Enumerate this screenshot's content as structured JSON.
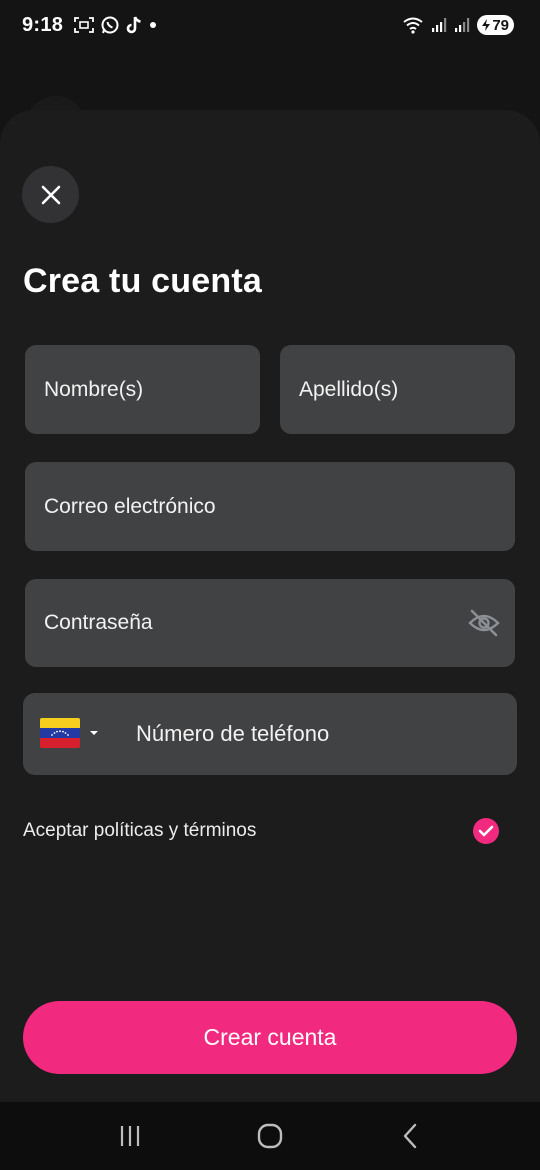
{
  "status_bar": {
    "time": "9:18",
    "left_icons": [
      "screenshot-icon",
      "whatsapp-icon",
      "tiktok-icon",
      "notification-dot-icon"
    ],
    "right_icons": [
      "wifi-icon",
      "signal-icon",
      "signal-icon"
    ],
    "battery_level": "79"
  },
  "header": {
    "close_icon": "close-icon",
    "title": "Crea tu cuenta"
  },
  "form": {
    "first_name_placeholder": "Nombre(s)",
    "last_name_placeholder": "Apellido(s)",
    "email_placeholder": "Correo electrónico",
    "password_placeholder": "Contraseña",
    "password_toggle_icon": "eye-off-icon",
    "phone": {
      "country_flag": "venezuela-flag-icon",
      "dropdown_icon": "caret-down-icon",
      "placeholder": "Número de teléfono"
    },
    "terms_label": "Aceptar políticas y términos",
    "terms_checked": true
  },
  "actions": {
    "create_account_label": "Crear cuenta"
  },
  "nav_bar": {
    "items": [
      "recents-icon",
      "home-icon",
      "back-icon"
    ]
  },
  "colors": {
    "accent": "#f22a7f",
    "background": "#141414",
    "sheet": "#1c1c1d",
    "field": "#414244"
  }
}
